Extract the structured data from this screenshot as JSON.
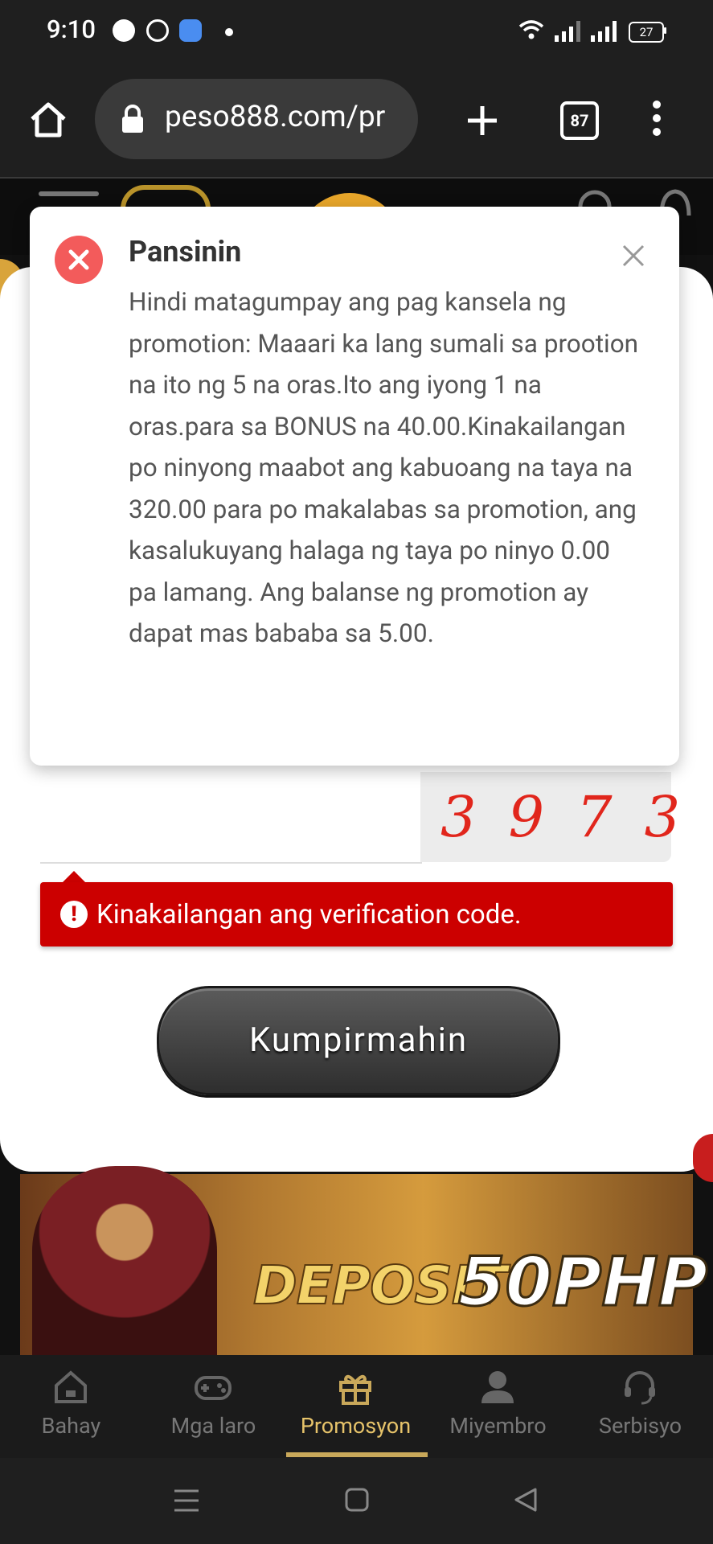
{
  "status_bar": {
    "time": "9:10",
    "battery": "27"
  },
  "browser": {
    "url": "peso888.com/pr",
    "tab_count": "87"
  },
  "form": {
    "captcha_code": "3973",
    "error_message": "Kinakailangan ang verification code.",
    "confirm_label": "Kumpirmahin"
  },
  "banner": {
    "deposit_text": "DEPOSIT",
    "amount_text": "50PHP"
  },
  "bottom_nav": {
    "items": [
      {
        "label": "Bahay",
        "icon": "home-icon"
      },
      {
        "label": "Mga laro",
        "icon": "gamepad-icon"
      },
      {
        "label": "Promosyon",
        "icon": "gift-icon",
        "active": true
      },
      {
        "label": "Miyembro",
        "icon": "user-icon"
      },
      {
        "label": "Serbisyo",
        "icon": "headset-icon"
      }
    ]
  },
  "dialog": {
    "title": "Pansinin",
    "message": "Hindi matagumpay ang pag kansela ng promotion: Maaari ka lang sumali sa prootion na ito ng 5 na oras.Ito ang iyong 1 na oras.para sa BONUS na 40.00.Kinakailangan po ninyong maabot ang kabuoang na taya na 320.00 para po makalabas sa promotion, ang kasalukuyang halaga ng taya po ninyo 0.00 pa lamang. Ang balanse ng promotion ay dapat mas bababa sa 5.00."
  },
  "colors": {
    "error_red": "#cc0000",
    "dialog_icon_red": "#f35b5b",
    "active_gold": "#e6c36a"
  }
}
